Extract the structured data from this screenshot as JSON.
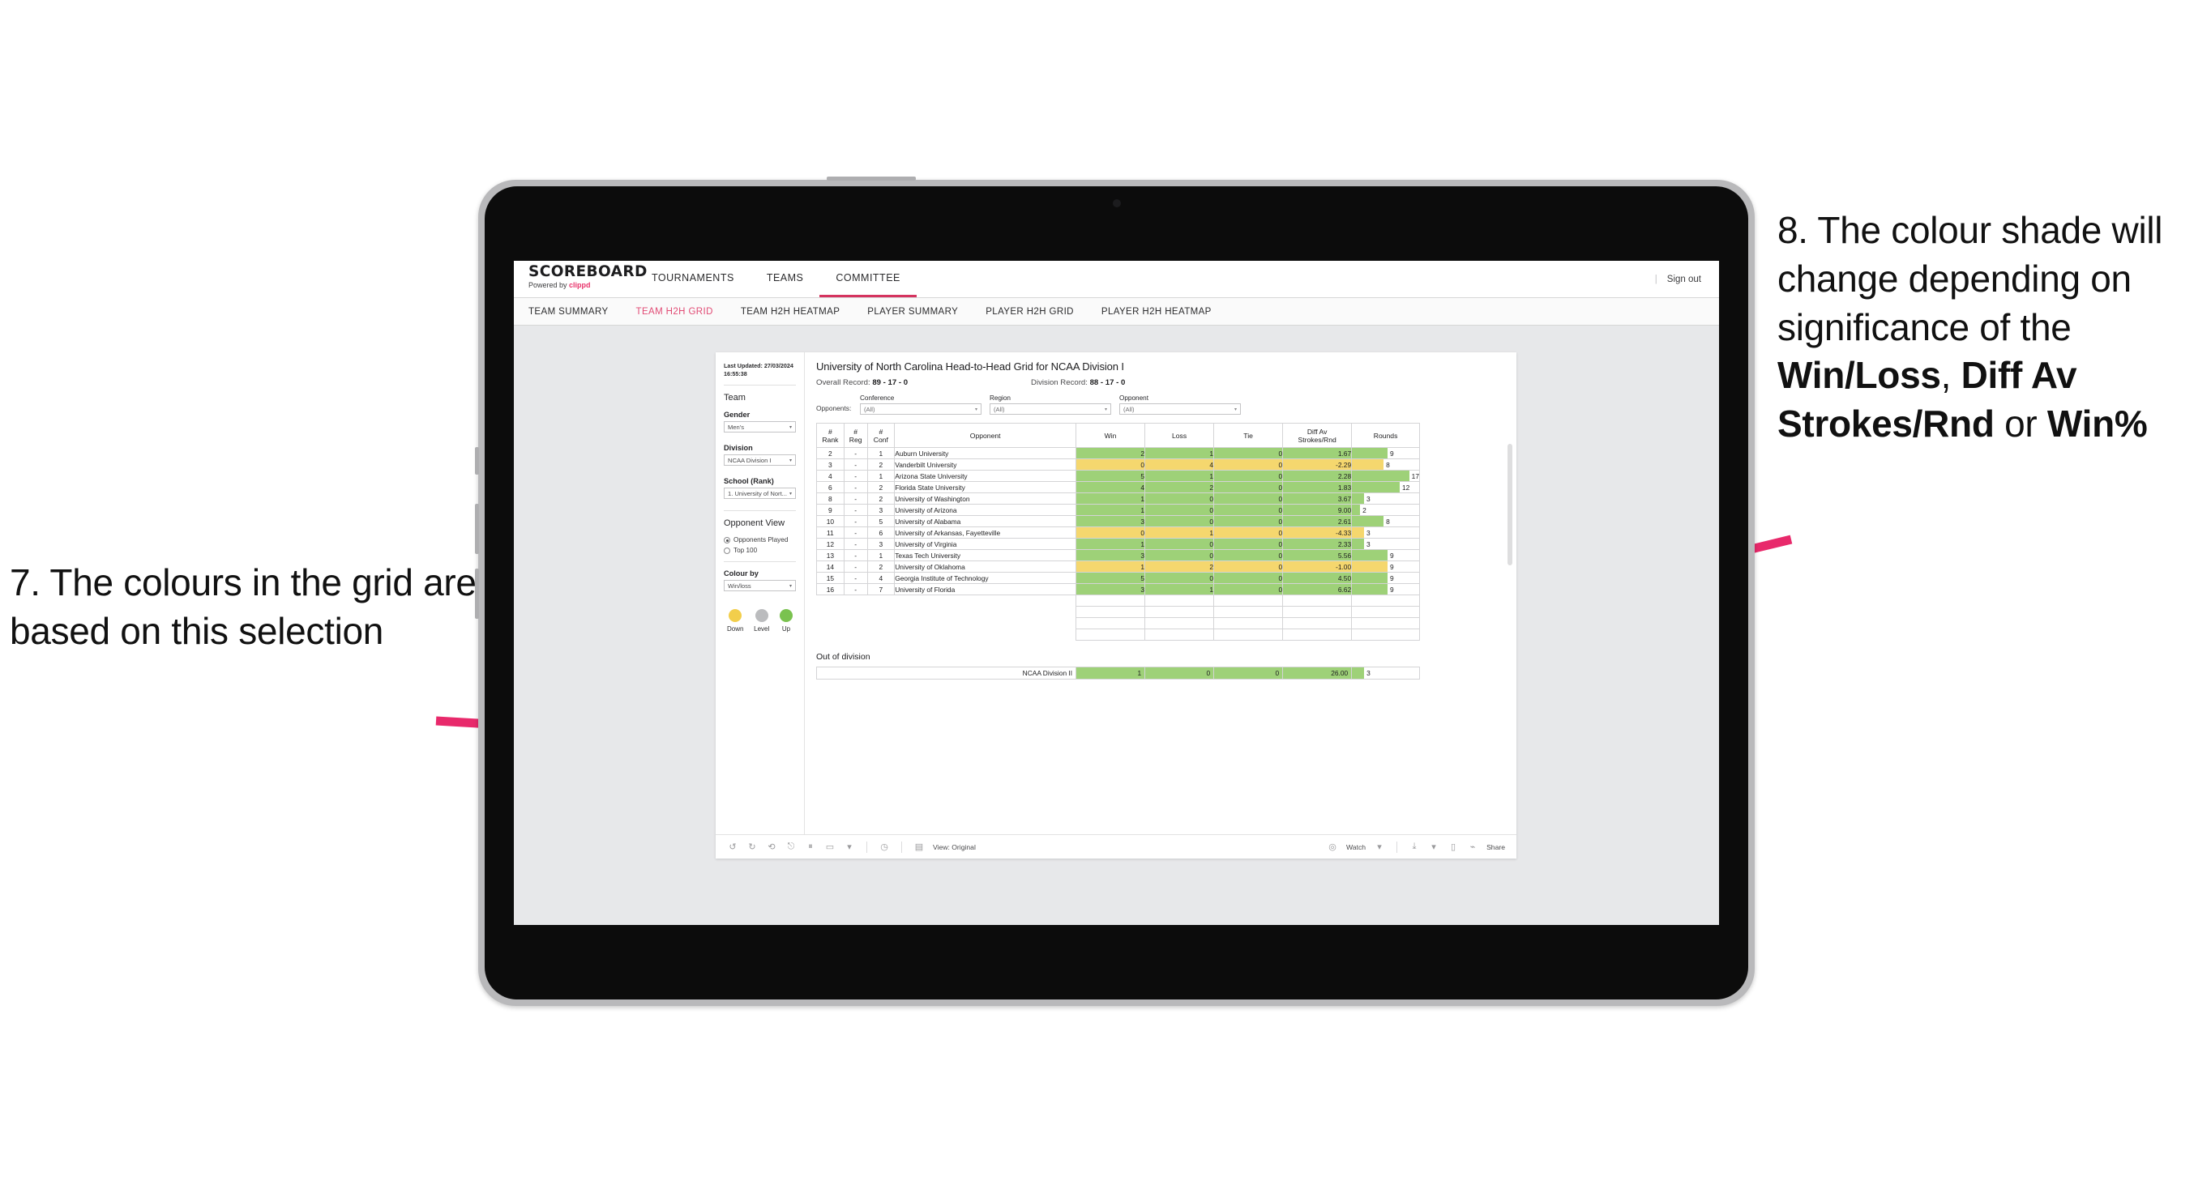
{
  "annotations": {
    "left": "7. The colours in the grid are based on this selection",
    "right_pre": "8. The colour shade will change depending on significance of the ",
    "right_b1": "Win/Loss",
    "right_mid1": ", ",
    "right_b2": "Diff Av Strokes/Rnd",
    "right_mid2": " or ",
    "right_b3": "Win%",
    "arrow_color": "#E8296B"
  },
  "topnav": {
    "brand_name": "SCOREBOARD",
    "brand_sub_pre": "Powered by ",
    "brand_sub_em": "clippd",
    "items": [
      {
        "label": "TOURNAMENTS",
        "active": false
      },
      {
        "label": "TEAMS",
        "active": false
      },
      {
        "label": "COMMITTEE",
        "active": true
      }
    ],
    "divider": "|",
    "signout": "Sign out"
  },
  "subnav": {
    "items": [
      {
        "label": "TEAM SUMMARY",
        "active": false
      },
      {
        "label": "TEAM H2H GRID",
        "active": true
      },
      {
        "label": "TEAM H2H HEATMAP",
        "active": false
      },
      {
        "label": "PLAYER SUMMARY",
        "active": false
      },
      {
        "label": "PLAYER H2H GRID",
        "active": false
      },
      {
        "label": "PLAYER H2H HEATMAP",
        "active": false
      }
    ]
  },
  "sidebar": {
    "last_updated": "Last Updated: 27/03/2024 16:55:38",
    "team_heading": "Team",
    "gender_label": "Gender",
    "gender_value": "Men's",
    "division_label": "Division",
    "division_value": "NCAA Division I",
    "school_label": "School (Rank)",
    "school_value": "1. University of Nort...",
    "opponent_view_heading": "Opponent View",
    "radio_opponents_played": "Opponents Played",
    "radio_top100": "Top 100",
    "colour_by_label": "Colour by",
    "colour_by_value": "Win/loss",
    "legend": [
      {
        "label": "Down",
        "color": "#f2ce4b"
      },
      {
        "label": "Level",
        "color": "#bbbcbe"
      },
      {
        "label": "Up",
        "color": "#7ac24f"
      }
    ]
  },
  "main": {
    "title": "University of North Carolina Head-to-Head Grid for NCAA Division I",
    "overall_record_label": "Overall Record: ",
    "overall_record_value": "89 - 17 - 0",
    "division_record_label": "Division Record: ",
    "division_record_value": "88 - 17 - 0",
    "opponents_lead": "Opponents:",
    "filters": [
      {
        "label": "Conference",
        "value": "(All)"
      },
      {
        "label": "Region",
        "value": "(All)"
      },
      {
        "label": "Opponent",
        "value": "(All)"
      }
    ]
  },
  "chart_data": {
    "type": "table",
    "title": "University of North Carolina Head-to-Head Grid for NCAA Division I",
    "columns": [
      "# Rank",
      "# Reg",
      "# Conf",
      "Opponent",
      "Win",
      "Loss",
      "Tie",
      "Diff Av Strokes/Rnd",
      "Rounds"
    ],
    "column_header_lines": [
      [
        "#",
        "Rank"
      ],
      [
        "#",
        "Reg"
      ],
      [
        "#",
        "Conf"
      ],
      [
        "Opponent"
      ],
      [
        "Win"
      ],
      [
        "Loss"
      ],
      [
        "Tie"
      ],
      [
        "Diff Av",
        "Strokes/Rnd"
      ],
      [
        "Rounds"
      ]
    ],
    "rounds_max": 17,
    "colors": {
      "up": "#9ed178",
      "down": "#f5d76e",
      "level": "#bbbcbe"
    },
    "rows": [
      {
        "rank": "2",
        "reg": "-",
        "conf": "1",
        "opponent": "Auburn University",
        "win": "2",
        "loss": "1",
        "tie": "0",
        "diff": "1.67",
        "rounds": 9,
        "shade": "up"
      },
      {
        "rank": "3",
        "reg": "-",
        "conf": "2",
        "opponent": "Vanderbilt University",
        "win": "0",
        "loss": "4",
        "tie": "0",
        "diff": "-2.29",
        "rounds": 8,
        "shade": "down"
      },
      {
        "rank": "4",
        "reg": "-",
        "conf": "1",
        "opponent": "Arizona State University",
        "win": "5",
        "loss": "1",
        "tie": "0",
        "diff": "2.28",
        "rounds": 17,
        "shade": "up"
      },
      {
        "rank": "6",
        "reg": "-",
        "conf": "2",
        "opponent": "Florida State University",
        "win": "4",
        "loss": "2",
        "tie": "0",
        "diff": "1.83",
        "rounds": 12,
        "shade": "up"
      },
      {
        "rank": "8",
        "reg": "-",
        "conf": "2",
        "opponent": "University of Washington",
        "win": "1",
        "loss": "0",
        "tie": "0",
        "diff": "3.67",
        "rounds": 3,
        "shade": "up"
      },
      {
        "rank": "9",
        "reg": "-",
        "conf": "3",
        "opponent": "University of Arizona",
        "win": "1",
        "loss": "0",
        "tie": "0",
        "diff": "9.00",
        "rounds": 2,
        "shade": "up"
      },
      {
        "rank": "10",
        "reg": "-",
        "conf": "5",
        "opponent": "University of Alabama",
        "win": "3",
        "loss": "0",
        "tie": "0",
        "diff": "2.61",
        "rounds": 8,
        "shade": "up"
      },
      {
        "rank": "11",
        "reg": "-",
        "conf": "6",
        "opponent": "University of Arkansas, Fayetteville",
        "win": "0",
        "loss": "1",
        "tie": "0",
        "diff": "-4.33",
        "rounds": 3,
        "shade": "down"
      },
      {
        "rank": "12",
        "reg": "-",
        "conf": "3",
        "opponent": "University of Virginia",
        "win": "1",
        "loss": "0",
        "tie": "0",
        "diff": "2.33",
        "rounds": 3,
        "shade": "up"
      },
      {
        "rank": "13",
        "reg": "-",
        "conf": "1",
        "opponent": "Texas Tech University",
        "win": "3",
        "loss": "0",
        "tie": "0",
        "diff": "5.56",
        "rounds": 9,
        "shade": "up"
      },
      {
        "rank": "14",
        "reg": "-",
        "conf": "2",
        "opponent": "University of Oklahoma",
        "win": "1",
        "loss": "2",
        "tie": "0",
        "diff": "-1.00",
        "rounds": 9,
        "shade": "down"
      },
      {
        "rank": "15",
        "reg": "-",
        "conf": "4",
        "opponent": "Georgia Institute of Technology",
        "win": "5",
        "loss": "0",
        "tie": "0",
        "diff": "4.50",
        "rounds": 9,
        "shade": "up"
      },
      {
        "rank": "16",
        "reg": "-",
        "conf": "7",
        "opponent": "University of Florida",
        "win": "3",
        "loss": "1",
        "tie": "0",
        "diff": "6.62",
        "rounds": 9,
        "shade": "up"
      }
    ],
    "out_of_division_title": "Out of division",
    "out_of_division": {
      "opponent": "NCAA Division II",
      "win": "1",
      "loss": "0",
      "tie": "0",
      "diff": "26.00",
      "rounds": 3,
      "shade": "up"
    }
  },
  "toolbar": {
    "undo_icon": "undo-icon",
    "redo_icon": "redo-icon",
    "revert_icon": "revert-icon",
    "refresh_icon": "refresh-icon",
    "pause_icon": "pause-icon",
    "alerts_icon": "alerts-icon",
    "view_label": "View: Original",
    "watch_label": "Watch",
    "share_label": "Share"
  }
}
